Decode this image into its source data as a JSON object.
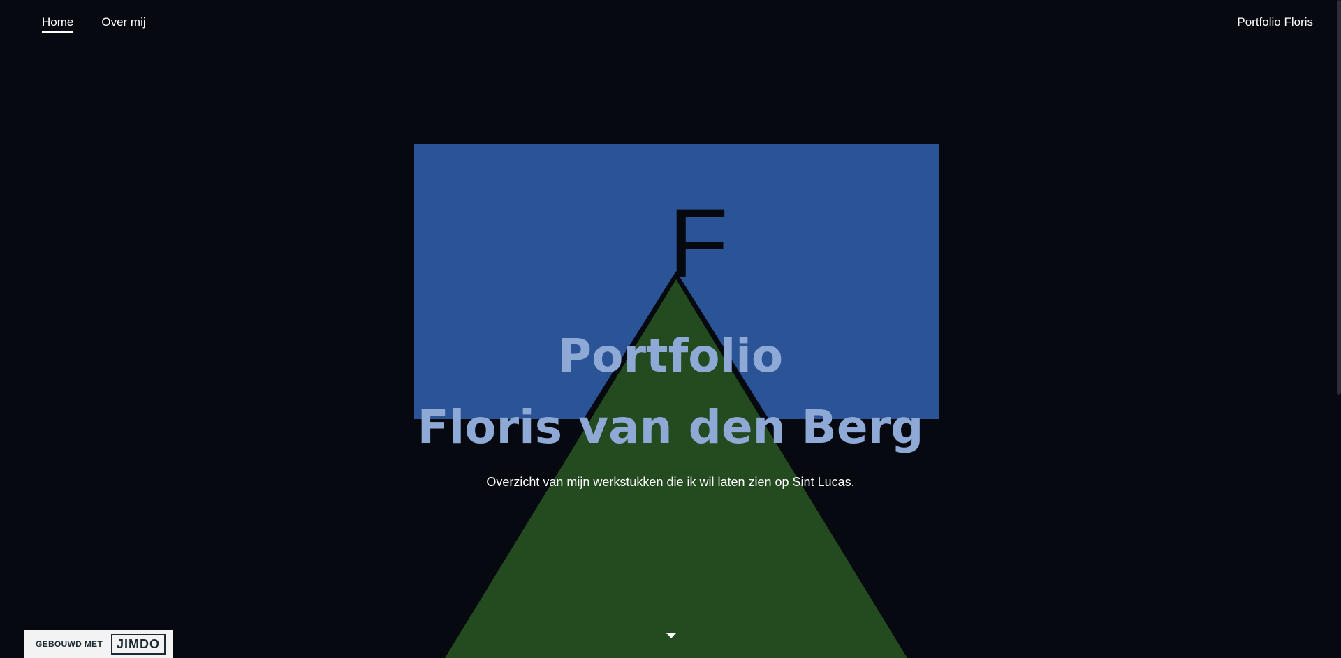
{
  "nav": {
    "items": [
      {
        "label": "Home",
        "active": true
      },
      {
        "label": "Over mij",
        "active": false
      }
    ],
    "site_title": "Portfolio Floris"
  },
  "hero": {
    "logo_letter": "F",
    "title_line_1": "Portfolio",
    "title_line_2": "Floris van den Berg",
    "subtitle": "Overzicht van mijn werkstukken die ik wil laten zien op Sint Lucas.",
    "scroll_icon": "caret-down-icon"
  },
  "badge": {
    "label": "GEBOUWD MET",
    "logo_text": "JIMDO"
  },
  "colors": {
    "background": "#060a10",
    "blue_panel": "#2b5497",
    "green_triangle": "#244a1f",
    "title_color": "#8ea9d6",
    "text_color": "#ffffff"
  }
}
